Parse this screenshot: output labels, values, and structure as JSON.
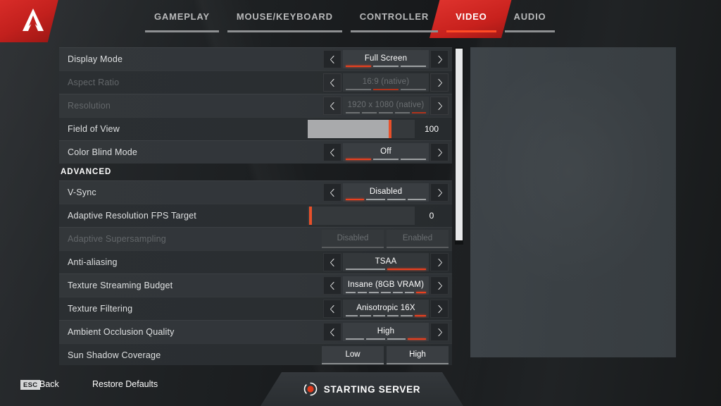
{
  "header": {
    "logo_icon": "apex-legends-logo-icon",
    "tabs": [
      {
        "label": "GAMEPLAY",
        "active": false
      },
      {
        "label": "MOUSE/KEYBOARD",
        "active": false
      },
      {
        "label": "CONTROLLER",
        "active": false
      },
      {
        "label": "VIDEO",
        "active": true
      },
      {
        "label": "AUDIO",
        "active": false
      }
    ]
  },
  "settings": {
    "rows": [
      {
        "label": "Display Mode",
        "type": "stepper",
        "value": "Full Screen",
        "segments": 3,
        "active_segment": 1,
        "disabled": false
      },
      {
        "label": "Aspect Ratio",
        "type": "stepper",
        "value": "16:9 (native)",
        "segments": 3,
        "active_segment": 2,
        "disabled": true
      },
      {
        "label": "Resolution",
        "type": "stepper",
        "value": "1920 x 1080 (native)",
        "segments": 5,
        "active_segment": 5,
        "disabled": true
      },
      {
        "label": "Field of View",
        "type": "slider",
        "value": "100",
        "fill_percent": 77,
        "disabled": false
      },
      {
        "label": "Color Blind Mode",
        "type": "stepper",
        "value": "Off",
        "segments": 3,
        "active_segment": 1,
        "disabled": false
      }
    ],
    "advanced_header": "ADVANCED",
    "advanced_rows": [
      {
        "label": "V-Sync",
        "type": "stepper",
        "value": "Disabled",
        "segments": 4,
        "active_segment": 1,
        "disabled": false
      },
      {
        "label": "Adaptive Resolution FPS Target",
        "type": "slider",
        "value": "0",
        "fill_percent": 0,
        "disabled": false
      },
      {
        "label": "Adaptive Supersampling",
        "type": "toggle",
        "options": [
          "Disabled",
          "Enabled"
        ],
        "disabled": true
      },
      {
        "label": "Anti-aliasing",
        "type": "stepper",
        "value": "TSAA",
        "segments": 2,
        "active_segment": 2,
        "disabled": false
      },
      {
        "label": "Texture Streaming Budget",
        "type": "stepper",
        "value": "Insane (8GB VRAM)",
        "segments": 7,
        "active_segment": 7,
        "disabled": false
      },
      {
        "label": "Texture Filtering",
        "type": "stepper",
        "value": "Anisotropic 16X",
        "segments": 6,
        "active_segment": 6,
        "disabled": false
      },
      {
        "label": "Ambient Occlusion Quality",
        "type": "stepper",
        "value": "High",
        "segments": 4,
        "active_segment": 4,
        "disabled": false
      },
      {
        "label": "Sun Shadow Coverage",
        "type": "toggle",
        "options": [
          "Low",
          "High"
        ],
        "disabled": false
      }
    ]
  },
  "footer": {
    "esc_key": "ESC",
    "back_label": "Back",
    "restore_label": "Restore Defaults",
    "status_text": "STARTING SERVER",
    "status_icon": "loading-spinner-icon"
  },
  "colors": {
    "accent_red": "#e8401f",
    "brand_red": "#c8211d",
    "row_bg": "#33373a",
    "panel_bg": "#3e4449"
  }
}
